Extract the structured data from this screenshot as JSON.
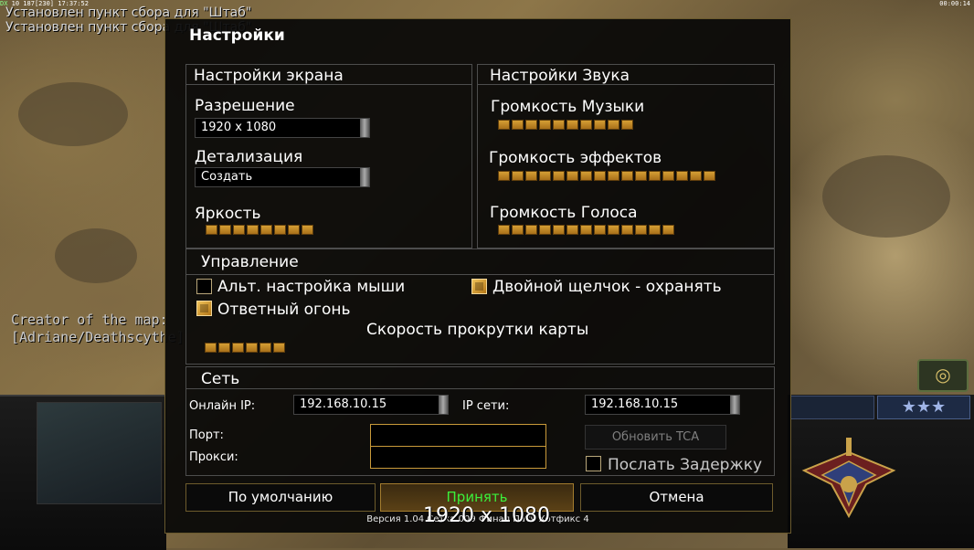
{
  "system": {
    "stats_prefix": "DX",
    "stats_text": " 10 187[230] 17:37:52",
    "clock": "00:00:14"
  },
  "messages": [
    "Установлен пункт сбора для \"Штаб\"",
    "Установлен пункт сбора для \"Штаб\""
  ],
  "map_creator": {
    "line1": "Creator of the map:",
    "line2": "[Adriane/Deathscythe]"
  },
  "hud": {
    "stars": "★★★",
    "radar_icon": "compass-icon"
  },
  "dialog": {
    "title": "Настройки",
    "screen": {
      "header": "Настройки экрана",
      "resolution_label": "Разрешение",
      "resolution_value": "1920 x 1080",
      "detail_label": "Детализация",
      "detail_value": "Создать",
      "brightness_label": "Яркость",
      "brightness_level": 8
    },
    "sound": {
      "header": "Настройки Звука",
      "music_label": "Громкость Музыки",
      "music_level": 10,
      "effects_label": "Громкость эффектов",
      "effects_level": 16,
      "voice_label": "Громкость Голоса",
      "voice_level": 13
    },
    "control": {
      "header": "Управление",
      "alt_mouse_label": "Альт. настройка мыши",
      "alt_mouse_checked": false,
      "double_click_label": "Двойной щелчок - охранять",
      "double_click_checked": true,
      "return_fire_label": "Ответный огонь",
      "return_fire_checked": true,
      "scroll_speed_label": "Скорость прокрутки карты",
      "scroll_speed_level": 6
    },
    "network": {
      "header": "Сеть",
      "online_ip_label": "Онлайн IP:",
      "online_ip_value": "192.168.10.15",
      "lan_ip_label": "IP сети:",
      "lan_ip_value": "192.168.10.15",
      "port_label": "Порт:",
      "port_value": "",
      "proxy_label": "Прокси:",
      "proxy_value": "",
      "update_tca_label": "Обновить TCA",
      "send_delay_label": "Послать Задержку",
      "send_delay_checked": false
    },
    "buttons": {
      "defaults": "По умолчанию",
      "accept": "Принять",
      "cancel": "Отмена"
    },
    "version_text": "Версия 1.04 Сетка 009 Финал Патч Хотфикс 4"
  },
  "overlay_resolution": "1920 x 1080",
  "colors": {
    "accent_gold": "#d59f34",
    "accept_green": "#3bf03b",
    "panel_border": "#4d4d4d"
  }
}
